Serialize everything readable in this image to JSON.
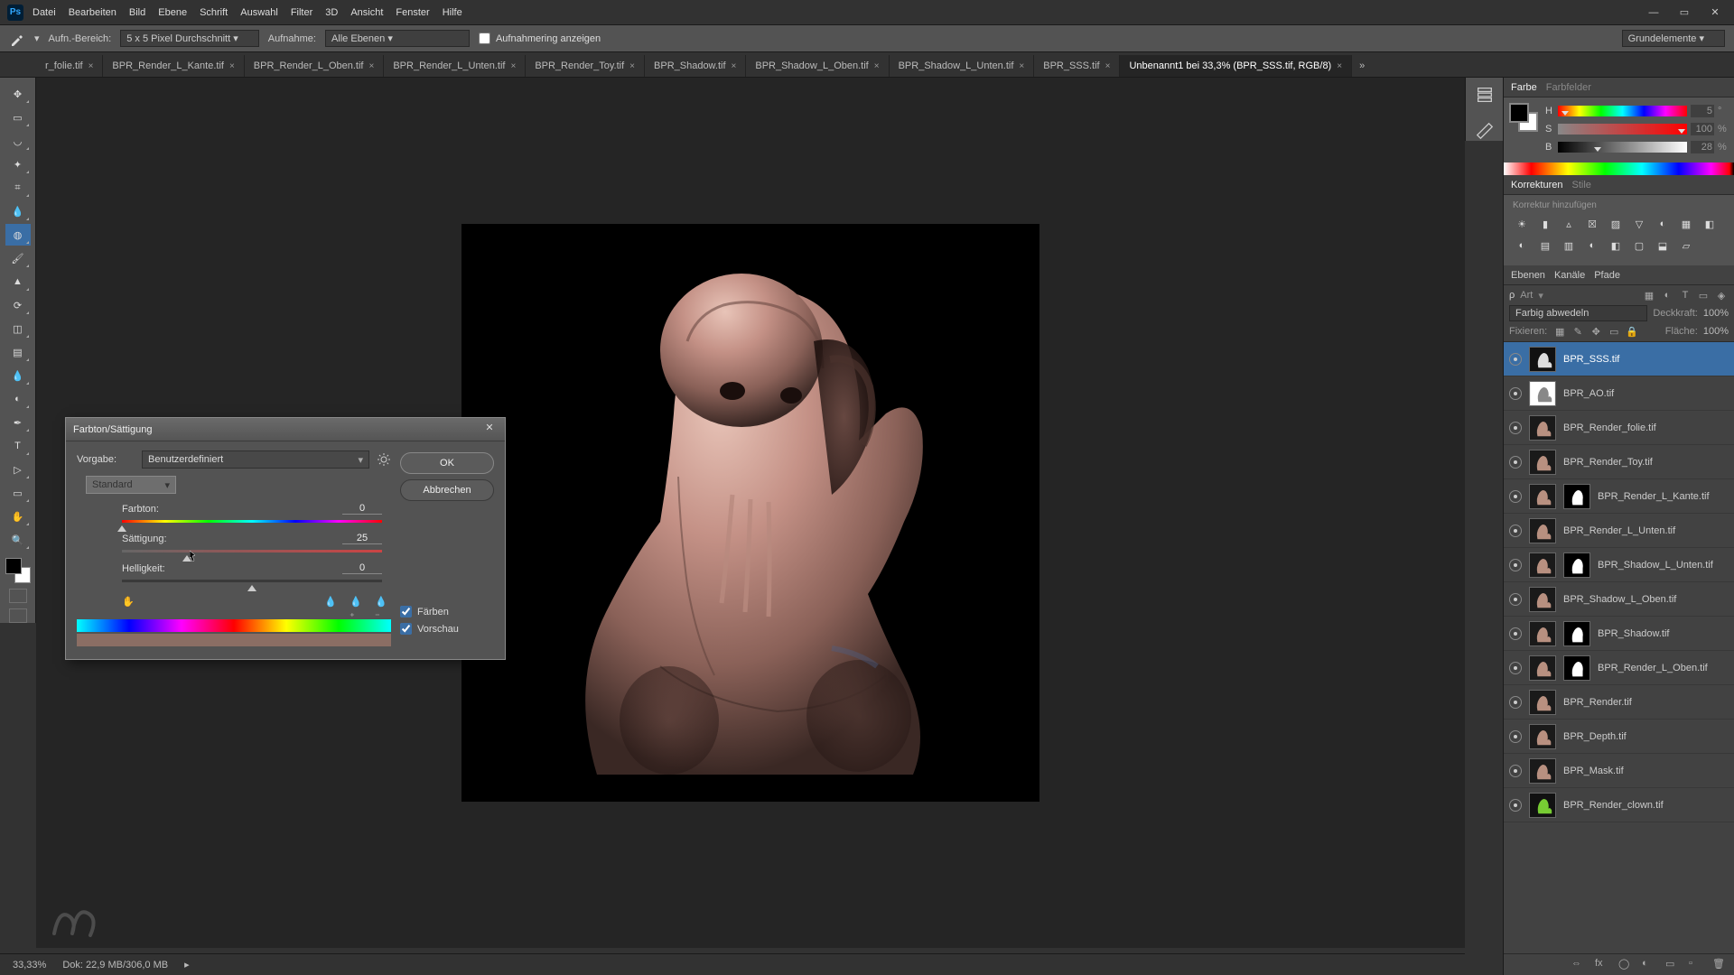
{
  "menu": [
    "Datei",
    "Bearbeiten",
    "Bild",
    "Ebene",
    "Schrift",
    "Auswahl",
    "Filter",
    "3D",
    "Ansicht",
    "Fenster",
    "Hilfe"
  ],
  "options": {
    "aufn": "Aufn.-Bereich:",
    "sample": "5 x 5 Pixel Durchschnitt",
    "aufnahme": "Aufnahme:",
    "alle": "Alle Ebenen",
    "ring": "Aufnahmering anzeigen",
    "grund": "Grundelemente"
  },
  "tabs": [
    "r_folie.tif",
    "BPR_Render_L_Kante.tif",
    "BPR_Render_L_Oben.tif",
    "BPR_Render_L_Unten.tif",
    "BPR_Render_Toy.tif",
    "BPR_Shadow.tif",
    "BPR_Shadow_L_Oben.tif",
    "BPR_Shadow_L_Unten.tif",
    "BPR_SSS.tif"
  ],
  "active_tab": "Unbenannt1 bei 33,3% (BPR_SSS.tif, RGB/8)",
  "color": {
    "tab1": "Farbe",
    "tab2": "Farbfelder",
    "h": "H",
    "s": "S",
    "b": "B",
    "hv": "5",
    "sv": "100",
    "bv": "28",
    "pct": "%",
    "deg": "°"
  },
  "adj": {
    "tab1": "Korrekturen",
    "tab2": "Stile",
    "label": "Korrektur hinzufügen"
  },
  "layers": {
    "t1": "Ebenen",
    "t2": "Kanäle",
    "t3": "Pfade",
    "mode": "Farbig abwedeln",
    "deck": "Deckkraft:",
    "fill": "Fläche:",
    "pct": "100%",
    "fix": "Fixieren:",
    "art": "Art",
    "filter": "Filter"
  },
  "layer_items": [
    {
      "n": "BPR_SSS.tif",
      "sel": true,
      "m": 0
    },
    {
      "n": "BPR_AO.tif",
      "m": 0
    },
    {
      "n": "BPR_Render_folie.tif",
      "m": 0
    },
    {
      "n": "BPR_Render_Toy.tif",
      "m": 0
    },
    {
      "n": "BPR_Render_L_Kante.tif",
      "m": 2
    },
    {
      "n": "BPR_Render_L_Unten.tif",
      "m": 0
    },
    {
      "n": "BPR_Shadow_L_Unten.tif",
      "m": 2
    },
    {
      "n": "BPR_Shadow_L_Oben.tif",
      "m": 0
    },
    {
      "n": "BPR_Shadow.tif",
      "m": 2
    },
    {
      "n": "BPR_Render_L_Oben.tif",
      "m": 2
    },
    {
      "n": "BPR_Render.tif",
      "m": 0
    },
    {
      "n": "BPR_Depth.tif",
      "m": 0
    },
    {
      "n": "BPR_Mask.tif",
      "m": 0
    },
    {
      "n": "BPR_Render_clown.tif",
      "m": 0
    }
  ],
  "status": {
    "zoom": "33,33%",
    "doc": "Dok: 22,9 MB/306,0 MB"
  },
  "dialog": {
    "title": "Farbton/Sättigung",
    "vorgabe": "Vorgabe:",
    "preset": "Benutzerdefiniert",
    "ok": "OK",
    "cancel": "Abbrechen",
    "channel": "Standard",
    "hue": "Farbton:",
    "hue_v": "0",
    "sat": "Sättigung:",
    "sat_v": "25",
    "lig": "Helligkeit:",
    "lig_v": "0",
    "colorize": "Färben",
    "preview": "Vorschau"
  }
}
